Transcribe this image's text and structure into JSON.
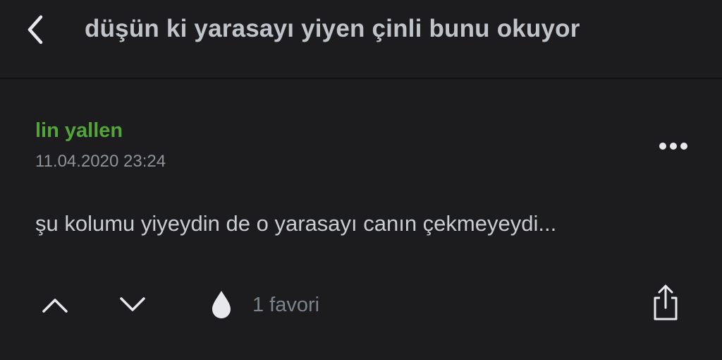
{
  "header": {
    "back_icon": "chevron-left-icon",
    "title": "düşün ki yarasayı yiyen çinli bunu okuyor"
  },
  "entry": {
    "author": "lin yallen",
    "timestamp": "11.04.2020 23:24",
    "more_icon": "ellipsis-icon",
    "text": "şu kolumu yiyeydin de o yarasayı canın çekmeyeydi..."
  },
  "actions": {
    "upvote_icon": "chevron-up-icon",
    "downvote_icon": "chevron-down-icon",
    "favorite_icon": "drop-icon",
    "favorite_count": "1 favori",
    "share_icon": "share-icon"
  },
  "colors": {
    "background": "#1c1c1e",
    "author": "#53a53a",
    "text": "#c9cdd2",
    "muted": "#8c939b"
  }
}
